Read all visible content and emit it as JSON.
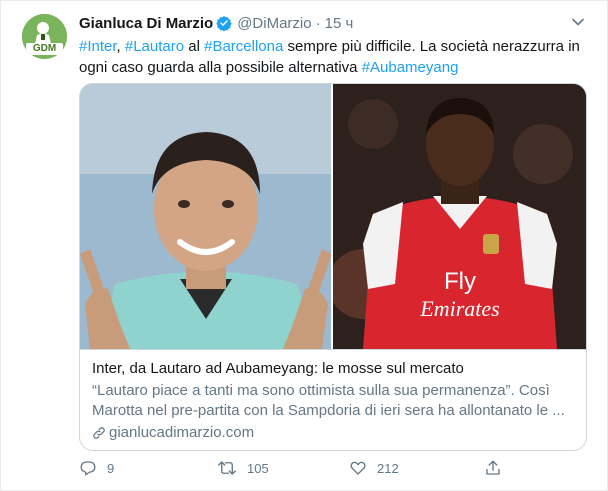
{
  "tweet": {
    "author_name": "Gianluca Di Marzio",
    "handle": "@DiMarzio",
    "separator": "·",
    "time": "15 ч",
    "avatar_badge": "GDM",
    "text_parts": [
      {
        "type": "hashtag",
        "text": "#Inter"
      },
      {
        "type": "plain",
        "text": ", "
      },
      {
        "type": "hashtag",
        "text": "#Lautaro"
      },
      {
        "type": "plain",
        "text": " al "
      },
      {
        "type": "hashtag",
        "text": "#Barcellona"
      },
      {
        "type": "plain",
        "text": " sempre più difficile. La società nerazzurra in ogni caso guarda alla possibile alternativa "
      },
      {
        "type": "hashtag",
        "text": "#Aubameyang"
      }
    ]
  },
  "card": {
    "title": "Inter, da Lautaro ad Aubameyang: le mosse sul mercato",
    "description": "“Lautaro piace a tanti ma sono ottimista sulla sua permanenza”. Così Marotta nel pre-partita con la Sampdoria di ieri sera ha allontanato le ...",
    "domain": "gianlucadimarzio.com",
    "left_photo_icon": "player-photo-lautaro",
    "right_photo_icon": "player-photo-aubameyang",
    "shirt_sponsor_line1": "Fly",
    "shirt_sponsor_line2": "Emirates"
  },
  "actions": {
    "reply_count": "9",
    "retweet_count": "105",
    "like_count": "212"
  },
  "colors": {
    "accent": "#1da1f2",
    "secondary_text": "#657786",
    "border": "#ccd6dd"
  }
}
